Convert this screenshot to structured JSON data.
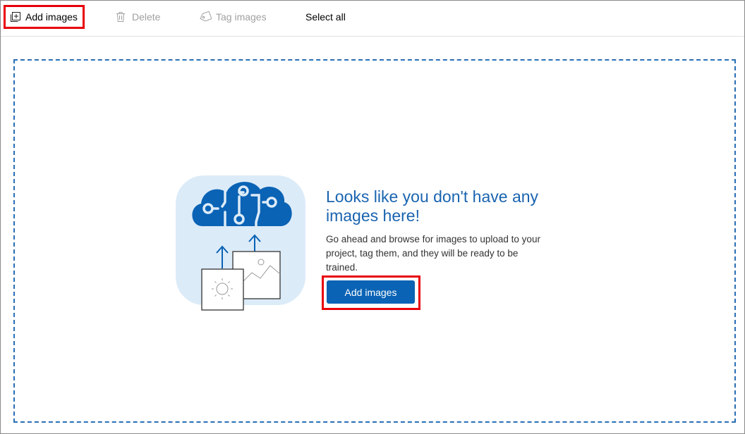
{
  "toolbar": {
    "add_images_label": "Add images",
    "delete_label": "Delete",
    "tag_images_label": "Tag images",
    "select_all_label": "Select all"
  },
  "empty_state": {
    "title": "Looks like you don't have any images here!",
    "description": "Go ahead and browse for images to upload to your project, tag them, and they will be ready to be trained.",
    "button_label": "Add images",
    "illustration": "cloud-upload-images-illustration"
  },
  "colors": {
    "accent": "#0a63b5",
    "title": "#1a64b0",
    "highlight": "#e8000a",
    "dropzone_border": "#2a6fb5",
    "illustration_bg": "#dcebf8",
    "disabled_text": "#a0a0a0"
  },
  "icons": {
    "add_images": "add-image-icon",
    "delete": "trash-icon",
    "tag_images": "tag-icon"
  }
}
